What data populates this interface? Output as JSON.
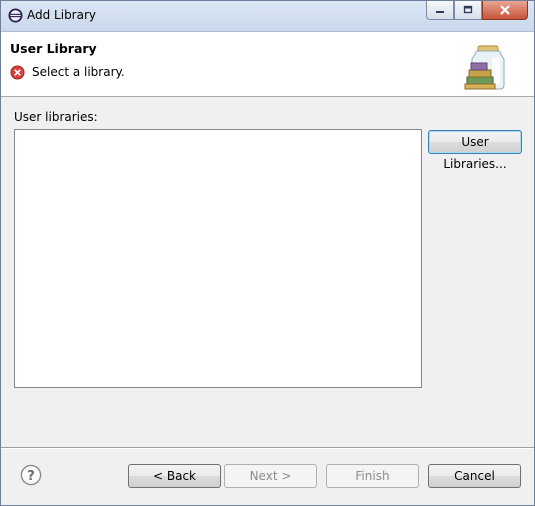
{
  "window": {
    "title": "Add Library",
    "app_icon": "eclipse-icon",
    "controls": [
      "minimize-icon",
      "maximize-icon",
      "close-icon"
    ]
  },
  "header": {
    "title": "User Library",
    "message": "Select a library.",
    "status_icon": "error-icon",
    "banner_icon": "library-jar-icon"
  },
  "main": {
    "list_label": "User libraries:",
    "list_items": [],
    "user_libraries_button": "User Libraries..."
  },
  "footer": {
    "help_icon": "help-icon",
    "back_label": "< Back",
    "next_label": "Next >",
    "finish_label": "Finish",
    "cancel_label": "Cancel"
  }
}
